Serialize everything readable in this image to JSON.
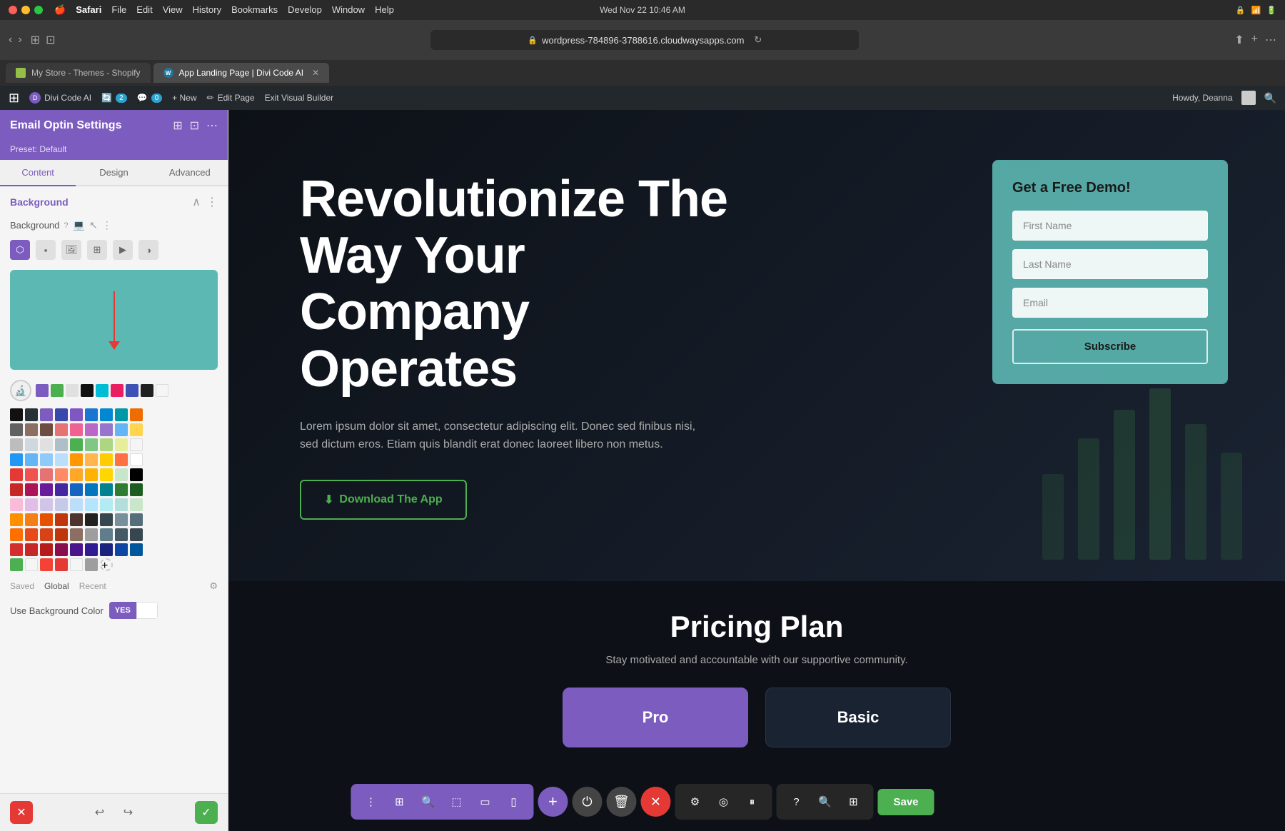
{
  "mac": {
    "traffic": [
      "red",
      "yellow",
      "green"
    ],
    "menu": [
      "Apple",
      "Safari",
      "File",
      "Edit",
      "View",
      "History",
      "Bookmarks",
      "Develop",
      "Window",
      "Help"
    ],
    "active_menu": "Safari",
    "time": "Wed Nov 22  10:46 AM",
    "url": "wordpress-784896-3788616.cloudwaysapps.com"
  },
  "browser": {
    "tab1_label": "My Store - Themes - Shopify",
    "tab2_label": "App Landing Page | Divi Code AI",
    "tab2_active": true,
    "reload_icon": "↻"
  },
  "wp_admin_bar": {
    "wp_icon": "W",
    "divi_label": "Divi Code AI",
    "counter": "2",
    "comment_count": "0",
    "new_label": "+ New",
    "edit_label": "Edit Page",
    "exit_label": "Exit Visual Builder",
    "howdy": "Howdy, Deanna"
  },
  "sidebar": {
    "title": "Email Optin Settings",
    "preset": "Preset: Default",
    "tabs": [
      "Content",
      "Design",
      "Advanced"
    ],
    "active_tab": "Content",
    "section_title": "Background",
    "bg_label": "Background",
    "bg_types": [
      "gradient",
      "color",
      "image",
      "pattern",
      "video",
      "mask"
    ],
    "active_bg_type": 0,
    "use_bg_label": "Use Background Color",
    "toggle_yes": "YES",
    "saved_label": "Saved",
    "global_label": "Global",
    "recent_label": "Recent"
  },
  "color_swatches": {
    "rows": [
      [
        "#7c5cbf",
        "#4caf50",
        "#e0e0e0",
        "#1a1a1a",
        "#00bcd4",
        "#e91e63",
        "#3f51b5",
        "#212121",
        "#757575"
      ],
      [
        "#1a1a1a",
        "#263238",
        "#7c5cbf",
        "#3f51b5",
        "#7e57c2",
        "#1976d2",
        "#0288d1",
        "#0097a7",
        "#ef6c00"
      ],
      [
        "#616161",
        "#8d6e63",
        "#6d4c41",
        "#e57373",
        "#f06292",
        "#ba68c8",
        "#9575cd",
        "#64b5f6",
        "#ffd54f"
      ],
      [
        "#bdbdbd",
        "#cfd8dc",
        "#e0e0e0",
        "#b0bec5",
        "#4caf50",
        "#81c784",
        "#aed581",
        "#e6ee9c",
        "#f5f5f5"
      ],
      [
        "#2196f3",
        "#64b5f6",
        "#90caf9",
        "#bbdefb",
        "#ff9800",
        "#ffb74d",
        "#ffcc02",
        "#ff7043",
        "#ffffff"
      ],
      [
        "#e53935",
        "#ef5350",
        "#e57373",
        "#ff8a65",
        "#ffa726",
        "#ffb300",
        "#ffd600",
        "#c8e6c9",
        "#000000"
      ],
      [
        "#c62828",
        "#ad1457",
        "#6a1b9a",
        "#4527a0",
        "#1565c0",
        "#0277bd",
        "#00838f",
        "#2e7d32",
        "#1b5e20"
      ],
      [
        "#f8bbd9",
        "#e1bee7",
        "#d1c4e9",
        "#c5cae9",
        "#bbdefb",
        "#b3e5fc",
        "#b2ebf2",
        "#b2dfdb",
        "#c8e6c9"
      ],
      [
        "#ff8f00",
        "#f57f17",
        "#e65100",
        "#bf360c",
        "#4e342e",
        "#212121",
        "#37474f",
        "#78909c",
        "#546e7a"
      ],
      [
        "#ff6f00",
        "#e64a19",
        "#d84315",
        "#bf360c",
        "#8d6e63",
        "#9e9e9e",
        "#607d8b",
        "#455a64",
        "#37474f"
      ],
      [
        "#d32f2f",
        "#c62828",
        "#b71c1c",
        "#880e4f",
        "#4a148c",
        "#311b92",
        "#1a237e",
        "#0d47a1",
        "#01579b"
      ],
      [
        "#4caf50",
        "#f5f5f5",
        "#f44336",
        "#f44336",
        "#f5f5f5",
        "#9e9e9e"
      ]
    ]
  },
  "hero": {
    "title": "Revolutionize The Way Your Company Operates",
    "description": "Lorem ipsum dolor sit amet, consectetur adipiscing elit. Donec sed finibus nisi, sed dictum eros. Etiam quis blandit erat donec laoreet libero non metus.",
    "download_btn": "Download The App",
    "form_title": "Get a Free Demo!",
    "first_name_placeholder": "First Name",
    "last_name_placeholder": "Last Name",
    "email_placeholder": "Email",
    "subscribe_btn": "Subscribe"
  },
  "pricing": {
    "title": "Pricing Plan",
    "description": "Stay motivated and accountable with our supportive community.",
    "cards": [
      {
        "name": "Pro"
      },
      {
        "name": "Basic"
      }
    ]
  },
  "bottom_toolbar": {
    "save_label": "Save",
    "settings_icon": "⚙",
    "target_icon": "◎",
    "equalizer_icon": "⏸"
  }
}
